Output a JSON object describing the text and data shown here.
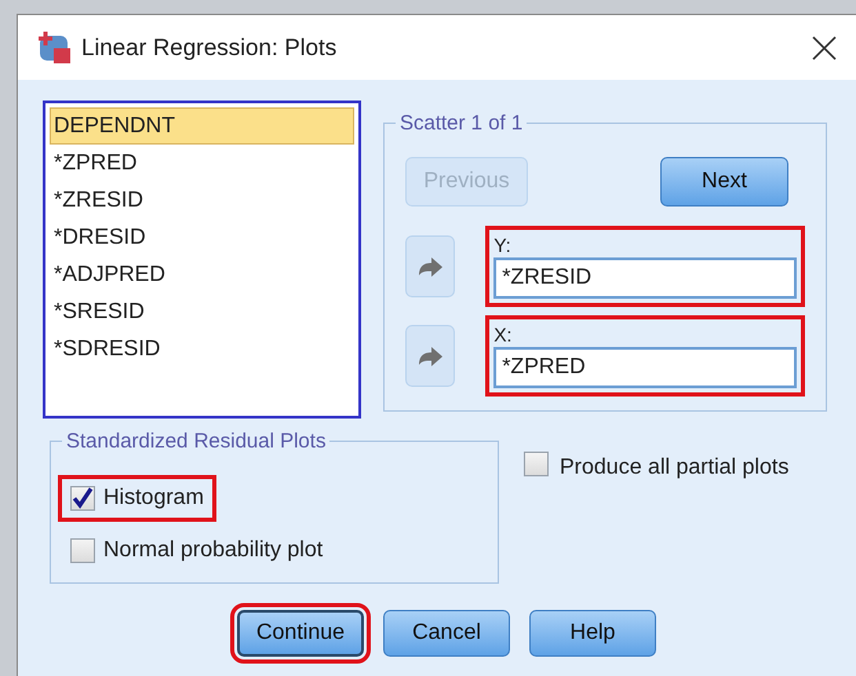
{
  "window": {
    "title": "Linear Regression: Plots"
  },
  "variables": [
    {
      "label": "DEPENDNT",
      "selected": true
    },
    {
      "label": "*ZPRED",
      "selected": false
    },
    {
      "label": "*ZRESID",
      "selected": false
    },
    {
      "label": "*DRESID",
      "selected": false
    },
    {
      "label": "*ADJPRED",
      "selected": false
    },
    {
      "label": "*SRESID",
      "selected": false
    },
    {
      "label": "*SDRESID",
      "selected": false
    }
  ],
  "scatter": {
    "title": "Scatter 1 of 1",
    "previous": {
      "label": "Previous",
      "disabled": true
    },
    "next": {
      "label": "Next",
      "disabled": false
    },
    "axes": [
      {
        "label": "Y:",
        "value": "*ZRESID",
        "highlighted": true
      },
      {
        "label": "X:",
        "value": "*ZPRED",
        "highlighted": true
      }
    ]
  },
  "residual_plots": {
    "title": "Standardized Residual Plots",
    "options": [
      {
        "label": "Histogram",
        "checked": true,
        "highlighted": true
      },
      {
        "label": "Normal probability plot",
        "checked": false,
        "highlighted": false
      }
    ]
  },
  "partial_plots": {
    "label": "Produce all partial plots",
    "checked": false
  },
  "buttons": [
    {
      "label": "Continue",
      "highlighted": true,
      "focused": true
    },
    {
      "label": "Cancel",
      "highlighted": false,
      "focused": false
    },
    {
      "label": "Help",
      "highlighted": false,
      "focused": false
    }
  ]
}
